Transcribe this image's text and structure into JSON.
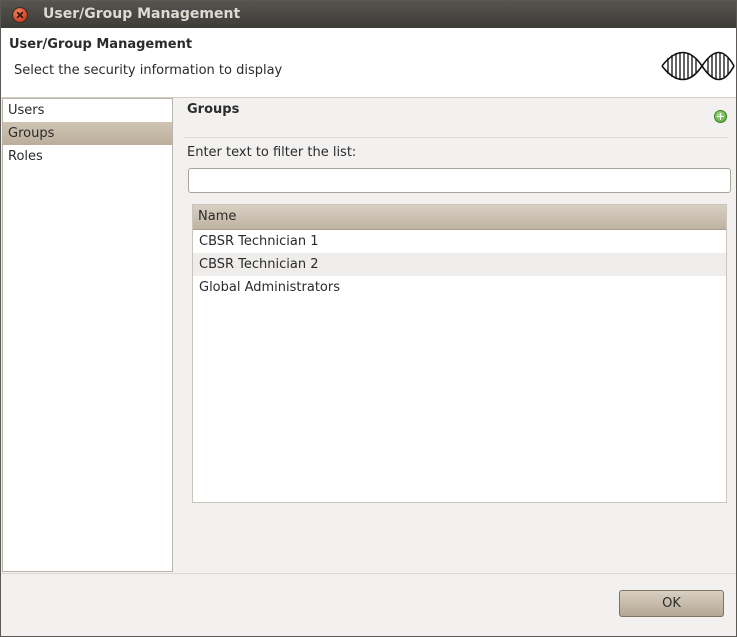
{
  "window": {
    "title": "User/Group Management"
  },
  "header": {
    "title": "User/Group Management",
    "description": "Select the security information to display"
  },
  "sidebar": {
    "items": [
      {
        "label": "Users",
        "selected": false
      },
      {
        "label": "Groups",
        "selected": true
      },
      {
        "label": "Roles",
        "selected": false
      }
    ]
  },
  "main": {
    "section_title": "Groups",
    "filter_label": "Enter text to filter the list:",
    "filter_value": "",
    "table": {
      "columns": [
        "Name"
      ],
      "rows": [
        "CBSR Technician 1",
        "CBSR Technician 2",
        "Global Administrators"
      ]
    }
  },
  "footer": {
    "ok_label": "OK"
  },
  "icons": {
    "close": "close-icon",
    "add": "add-icon",
    "logo": "dna-logo"
  },
  "colors": {
    "selection": "#c4b8a6",
    "close_button": "#d6492a",
    "add_icon": "#4ca22e"
  }
}
